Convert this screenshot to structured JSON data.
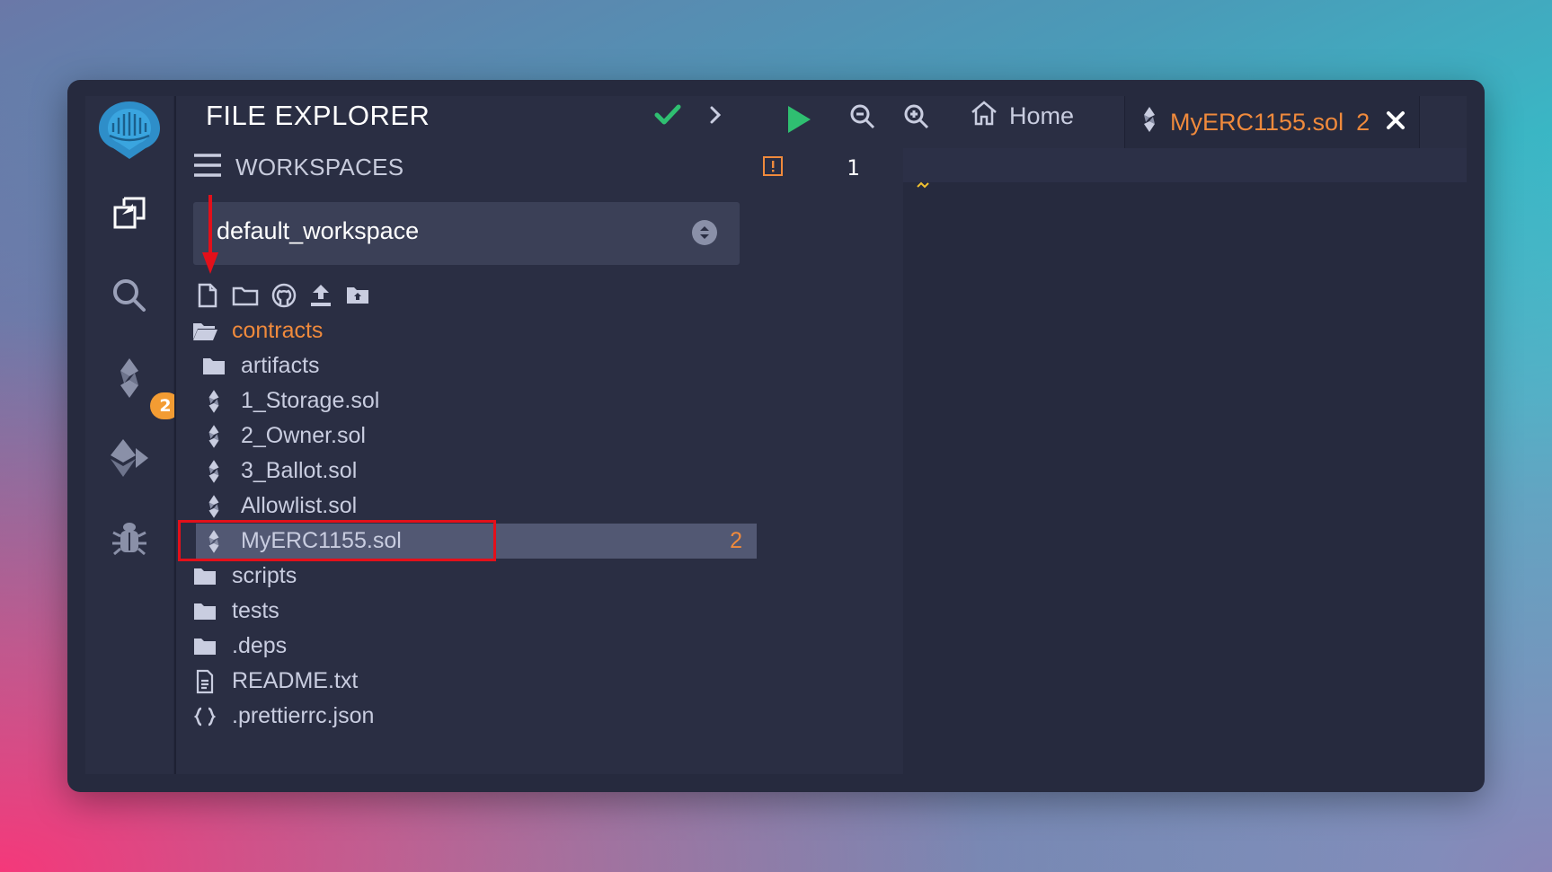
{
  "explorer": {
    "title": "FILE EXPLORER",
    "workspaces_label": "WORKSPACES",
    "workspace_selected": "default_workspace"
  },
  "icon_badge": "2",
  "tree": [
    {
      "name": "contracts",
      "icon": "folder-open-icon",
      "depth": 0,
      "style": "orange"
    },
    {
      "name": "artifacts",
      "icon": "folder-icon",
      "depth": 1
    },
    {
      "name": "1_Storage.sol",
      "icon": "solidity-icon",
      "depth": 1
    },
    {
      "name": "2_Owner.sol",
      "icon": "solidity-icon",
      "depth": 1
    },
    {
      "name": "3_Ballot.sol",
      "icon": "solidity-icon",
      "depth": 1
    },
    {
      "name": "Allowlist.sol",
      "icon": "solidity-icon",
      "depth": 1
    },
    {
      "name": "MyERC1155.sol",
      "icon": "solidity-icon",
      "depth": 1,
      "style": "selected",
      "count": "2"
    },
    {
      "name": "scripts",
      "icon": "folder-icon",
      "depth": 0
    },
    {
      "name": "tests",
      "icon": "folder-icon",
      "depth": 0
    },
    {
      "name": ".deps",
      "icon": "folder-icon",
      "depth": 0
    },
    {
      "name": "README.txt",
      "icon": "text-file-icon",
      "depth": 0
    },
    {
      "name": ".prettierrc.json",
      "icon": "json-icon",
      "depth": 0
    }
  ],
  "editor": {
    "home_tab": "Home",
    "file_tab": "MyERC1155.sol",
    "file_tab_count": "2",
    "line_number": "1"
  },
  "colors": {
    "accent_orange": "#f08a3c",
    "check_green": "#2fbf71",
    "highlight_red": "#e3101a"
  }
}
